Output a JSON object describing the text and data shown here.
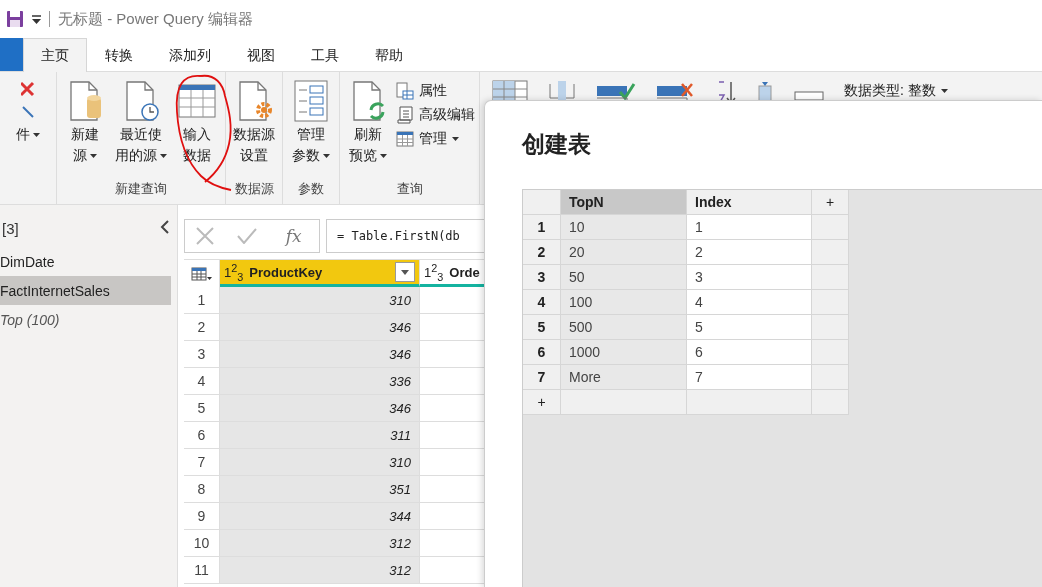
{
  "window": {
    "title": "无标题 - Power Query 编辑器"
  },
  "tabs": [
    {
      "label": "主页",
      "selected": true
    },
    {
      "label": "转换",
      "selected": false
    },
    {
      "label": "添加列",
      "selected": false
    },
    {
      "label": "视图",
      "selected": false
    },
    {
      "label": "工具",
      "selected": false
    },
    {
      "label": "帮助",
      "selected": false
    }
  ],
  "ribbon": {
    "groups": [
      {
        "buttons": [
          {
            "lines": [
              "件"
            ],
            "dropdown": true
          }
        ]
      },
      {
        "label": "新建查询",
        "buttons": [
          {
            "lines": [
              "新建",
              "源"
            ],
            "dropdown": true
          },
          {
            "lines": [
              "最近使",
              "用的源"
            ],
            "dropdown": true
          },
          {
            "lines": [
              "输入",
              "数据"
            ],
            "dropdown": false
          }
        ]
      },
      {
        "label": "数据源",
        "buttons": [
          {
            "lines": [
              "数据源",
              "设置"
            ],
            "dropdown": false
          }
        ]
      },
      {
        "label": "参数",
        "buttons": [
          {
            "lines": [
              "管理",
              "参数"
            ],
            "dropdown": true
          }
        ]
      },
      {
        "label": "查询",
        "buttons": [
          {
            "lines": [
              "刷新",
              "预览"
            ],
            "dropdown": true
          }
        ],
        "small_buttons": [
          {
            "label": "属性",
            "dropdown": false
          },
          {
            "label": "高级编辑",
            "dropdown": false
          },
          {
            "label": "管理",
            "dropdown": true
          }
        ]
      }
    ],
    "data_type": {
      "label": "数据类型: 整数",
      "dropdown": true
    }
  },
  "queries": {
    "count": "[3]",
    "items": [
      {
        "name": "DimDate",
        "kind": "query",
        "selected": false
      },
      {
        "name": "FactInternetSales",
        "kind": "query",
        "selected": true
      },
      {
        "name": "Top (100)",
        "kind": "parameter",
        "selected": false
      }
    ]
  },
  "formula_bar": {
    "function_label": "fx",
    "formula": "= Table.FirstN(db"
  },
  "grid": {
    "columns": [
      {
        "type": "1$^{2}$$_{3}$",
        "name": "ProductKey",
        "selected": true
      },
      {
        "type": "1$^{2}$$_{3}$",
        "name": "Orde",
        "selected": false
      }
    ],
    "rows": [
      {
        "num": "1",
        "values": [
          "310"
        ]
      },
      {
        "num": "2",
        "values": [
          "346"
        ]
      },
      {
        "num": "3",
        "values": [
          "346"
        ]
      },
      {
        "num": "4",
        "values": [
          "336"
        ]
      },
      {
        "num": "5",
        "values": [
          "346"
        ]
      },
      {
        "num": "6",
        "values": [
          "311"
        ]
      },
      {
        "num": "7",
        "values": [
          "310"
        ]
      },
      {
        "num": "8",
        "values": [
          "351"
        ]
      },
      {
        "num": "9",
        "values": [
          "344"
        ]
      },
      {
        "num": "10",
        "values": [
          "312"
        ]
      },
      {
        "num": "11",
        "values": [
          "312"
        ]
      }
    ]
  },
  "dialog": {
    "title": "创建表",
    "columns": [
      {
        "name": "TopN",
        "selected": true
      },
      {
        "name": "Index",
        "selected": false
      }
    ],
    "add_column": "+",
    "add_row": "+",
    "rows": [
      {
        "num": "1",
        "values": [
          "10",
          "1"
        ]
      },
      {
        "num": "2",
        "values": [
          "20",
          "2"
        ]
      },
      {
        "num": "3",
        "values": [
          "50",
          "3"
        ]
      },
      {
        "num": "4",
        "values": [
          "100",
          "4"
        ]
      },
      {
        "num": "5",
        "values": [
          "500",
          "5"
        ]
      },
      {
        "num": "6",
        "values": [
          "1000",
          "6"
        ]
      },
      {
        "num": "7",
        "values": [
          "More",
          "7"
        ]
      }
    ]
  }
}
